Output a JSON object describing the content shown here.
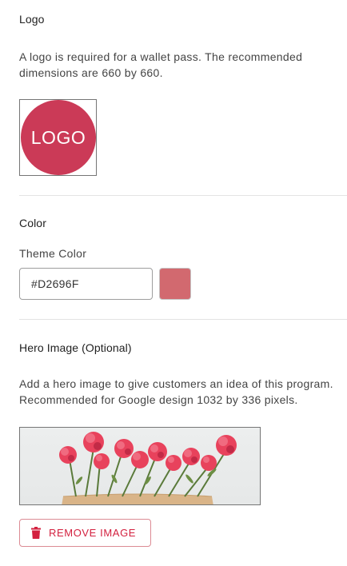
{
  "logo_section": {
    "title": "Logo",
    "description": "A logo is required for a wallet pass. The recommended dimensions are 660 by 660.",
    "placeholder_text": "LOGO",
    "circle_color": "#CB3A57"
  },
  "color_section": {
    "title": "Color",
    "field_label": "Theme Color",
    "value": "#D2696F",
    "swatch_color": "#D2696F"
  },
  "hero_section": {
    "title": "Hero Image (Optional)",
    "description": "Add a hero image to give customers an idea of this program. Recommended for Google design 1032 by 336 pixels.",
    "image_subject": "red carnations in kraft paper"
  },
  "remove_button": {
    "label": "REMOVE IMAGE",
    "icon": "trash-icon",
    "color": "#D3213F"
  }
}
